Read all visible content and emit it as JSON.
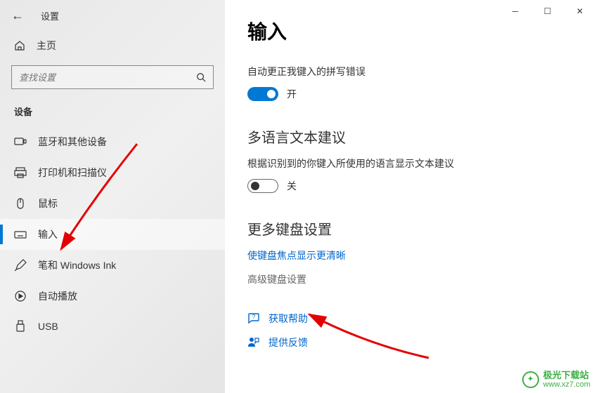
{
  "titlebar": {
    "title": "设置"
  },
  "home": {
    "label": "主页"
  },
  "search": {
    "placeholder": "查找设置"
  },
  "category": "设备",
  "nav": {
    "items": [
      {
        "label": "蓝牙和其他设备"
      },
      {
        "label": "打印机和扫描仪"
      },
      {
        "label": "鼠标"
      },
      {
        "label": "输入"
      },
      {
        "label": "笔和 Windows Ink"
      },
      {
        "label": "自动播放"
      },
      {
        "label": "USB"
      }
    ]
  },
  "content": {
    "page_title": "输入",
    "autocorrect_label": "自动更正我键入的拼写错误",
    "autocorrect_state": "开",
    "multilang_title": "多语言文本建议",
    "multilang_desc": "根据识别到的你键入所使用的语言显示文本建议",
    "multilang_state": "关",
    "keyboard_title": "更多键盘设置",
    "link_focus": "使键盘焦点显示更清晰",
    "link_advanced": "高级键盘设置",
    "link_help": "获取帮助",
    "link_feedback": "提供反馈"
  },
  "watermark": {
    "cn": "极光下载站",
    "url": "www.xz7.com"
  }
}
